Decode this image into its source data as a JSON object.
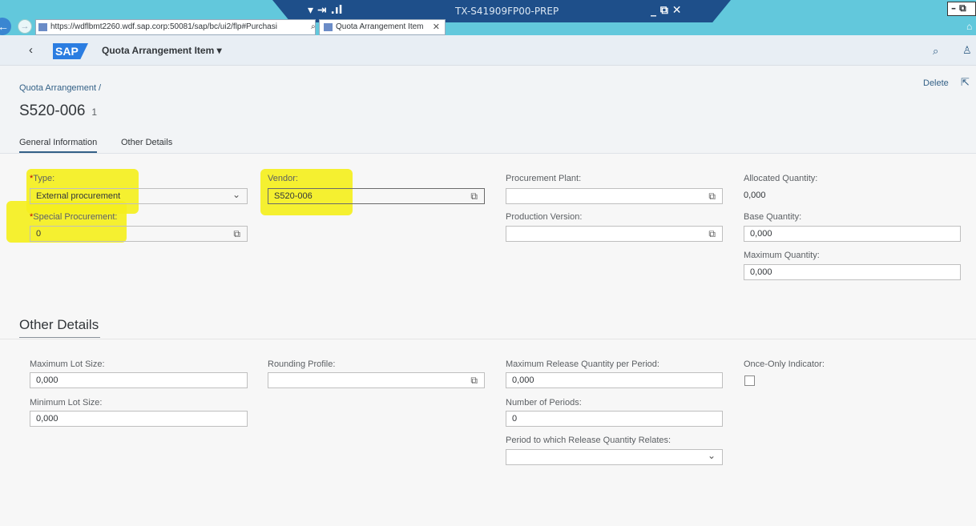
{
  "browser": {
    "rdp_title": "TX-S41909FP00-PREP",
    "rdp_pin": "▾ ⇥ .ıl",
    "rdp_controls": "_ ⧉ ✕",
    "url": "https://wdflbmt2260.wdf.sap.corp:50081/sap/bc/ui2/flp#Purchasi",
    "addr_tools": "⌕ ▾ 🔒 C",
    "tab_label": "Quota Arrangement Item",
    "tab_close": "✕",
    "window_controls": "– ⧉"
  },
  "shell": {
    "logo": "SAP",
    "title": "Quota Arrangement Item ▾",
    "icons": [
      "back-icon",
      "search-icon",
      "user-icon"
    ]
  },
  "header": {
    "breadcrumb": "Quota Arrangement /",
    "title": "S520-006",
    "count": "1",
    "delete_label": "Delete",
    "tabs": [
      "General Information",
      "Other Details"
    ]
  },
  "general": {
    "type_label": "Type:",
    "type_value": "External procurement",
    "special_label": "Special Procurement:",
    "special_value": "0",
    "vendor_label": "Vendor:",
    "vendor_value": "S520-006",
    "proc_plant_label": "Procurement Plant:",
    "proc_plant_value": "",
    "prod_version_label": "Production Version:",
    "prod_version_value": "",
    "allocated_label": "Allocated Quantity:",
    "allocated_value": "0,000",
    "base_label": "Base Quantity:",
    "base_value": "0,000",
    "max_qty_label": "Maximum Quantity:",
    "max_qty_value": "0,000"
  },
  "other": {
    "section_title": "Other Details",
    "max_lot_label": "Maximum Lot Size:",
    "max_lot_value": "0,000",
    "min_lot_label": "Minimum Lot Size:",
    "min_lot_value": "0,000",
    "rounding_label": "Rounding Profile:",
    "rounding_value": "",
    "max_release_label": "Maximum Release Quantity per Period:",
    "max_release_value": "0,000",
    "num_periods_label": "Number of Periods:",
    "num_periods_value": "0",
    "period_relates_label": "Period to which Release Quantity Relates:",
    "period_relates_value": "",
    "once_only_label": "Once-Only Indicator:",
    "once_only_checked": false
  },
  "colors": {
    "shell_bg": "#e8eef4",
    "link": "#346187",
    "highlight": "#f4ef1e",
    "required": "#bb0000"
  }
}
